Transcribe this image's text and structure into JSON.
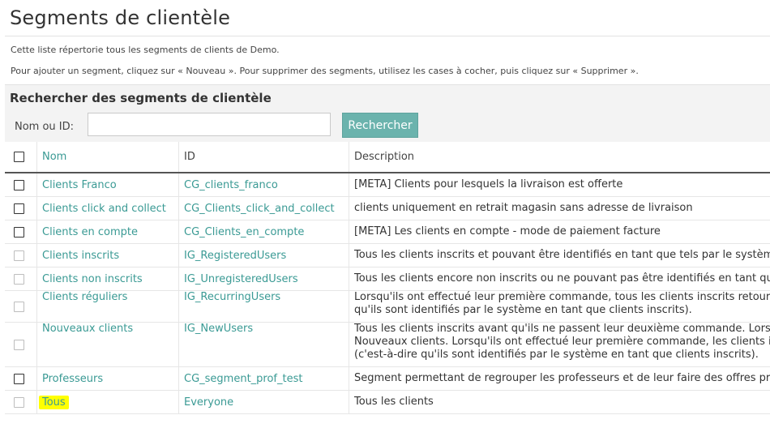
{
  "page": {
    "title": "Segments de clientèle",
    "intro_1": "Cette liste répertorie tous les segments de clients de Demo.",
    "intro_2": "Pour ajouter un segment, cliquez sur « Nouveau ». Pour supprimer des segments, utilisez les cases à cocher, puis cliquez sur « Supprimer »."
  },
  "search": {
    "title": "Rechercher des segments de clientèle",
    "label": "Nom ou ID:",
    "value": "",
    "button_label": "Rechercher"
  },
  "table": {
    "columns": [
      "Nom",
      "ID",
      "Description"
    ],
    "rows": [
      {
        "name": "Clients Franco",
        "id": "CG_clients_franco",
        "desc": "[META] Clients pour lesquels la livraison est offerte",
        "desc_2": "",
        "desc_3": "",
        "checkbox": "dark"
      },
      {
        "name": "Clients click and collect",
        "id": "CG_Clients_click_and_collect",
        "desc": "clients uniquement en retrait magasin sans adresse de livraison",
        "desc_2": "",
        "desc_3": "",
        "checkbox": "dark"
      },
      {
        "name": "Clients en compte",
        "id": "CG_Clients_en_compte",
        "desc": "[META] Les clients en compte - mode de paiement facture",
        "desc_2": "",
        "desc_3": "",
        "checkbox": "dark"
      },
      {
        "name": "Clients inscrits",
        "id": "IG_RegisteredUsers",
        "desc": "Tous les clients inscrits et pouvant être identifiés en tant que tels par le système",
        "desc_2": "",
        "desc_3": "",
        "checkbox": "light"
      },
      {
        "name": "Clients non inscrits",
        "id": "IG_UnregisteredUsers",
        "desc": "Tous les clients encore non inscrits ou ne pouvant pas être identifiés en tant que clients inscrits",
        "desc_2": "",
        "desc_3": "",
        "checkbox": "light"
      },
      {
        "name": "Clients réguliers",
        "id": "IG_RecurringUsers",
        "desc": "Lorsqu'ils ont effectué leur première commande, tous les clients inscrits retournent",
        "desc_2": "qu'ils sont identifiés par le système en tant que clients inscrits).",
        "desc_3": "",
        "checkbox": "light"
      },
      {
        "name": "Nouveaux clients",
        "id": "IG_NewUsers",
        "desc": "Tous les clients inscrits avant qu'ils ne passent leur deuxième commande. Lorsqu'ils",
        "desc_2": "Nouveaux clients. Lorsqu'ils ont effectué leur première commande, les clients inscrits",
        "desc_3": "(c'est-à-dire qu'ils sont identifiés par le système en tant que clients inscrits).",
        "checkbox": "light"
      },
      {
        "name": "Professeurs",
        "id": "CG_segment_prof_test",
        "desc": "Segment permettant de regrouper les professeurs et de leur faire des offres promotionnelles",
        "desc_2": "",
        "desc_3": "",
        "checkbox": "dark"
      },
      {
        "name": "Tous",
        "id": "Everyone",
        "desc": "Tous les clients",
        "desc_2": "",
        "desc_3": "",
        "checkbox": "light",
        "highlight": "#ffff00"
      }
    ]
  },
  "colors": {
    "accent": "#3a9a94",
    "button": "#6bb3ad",
    "highlight": "#ffff00"
  }
}
